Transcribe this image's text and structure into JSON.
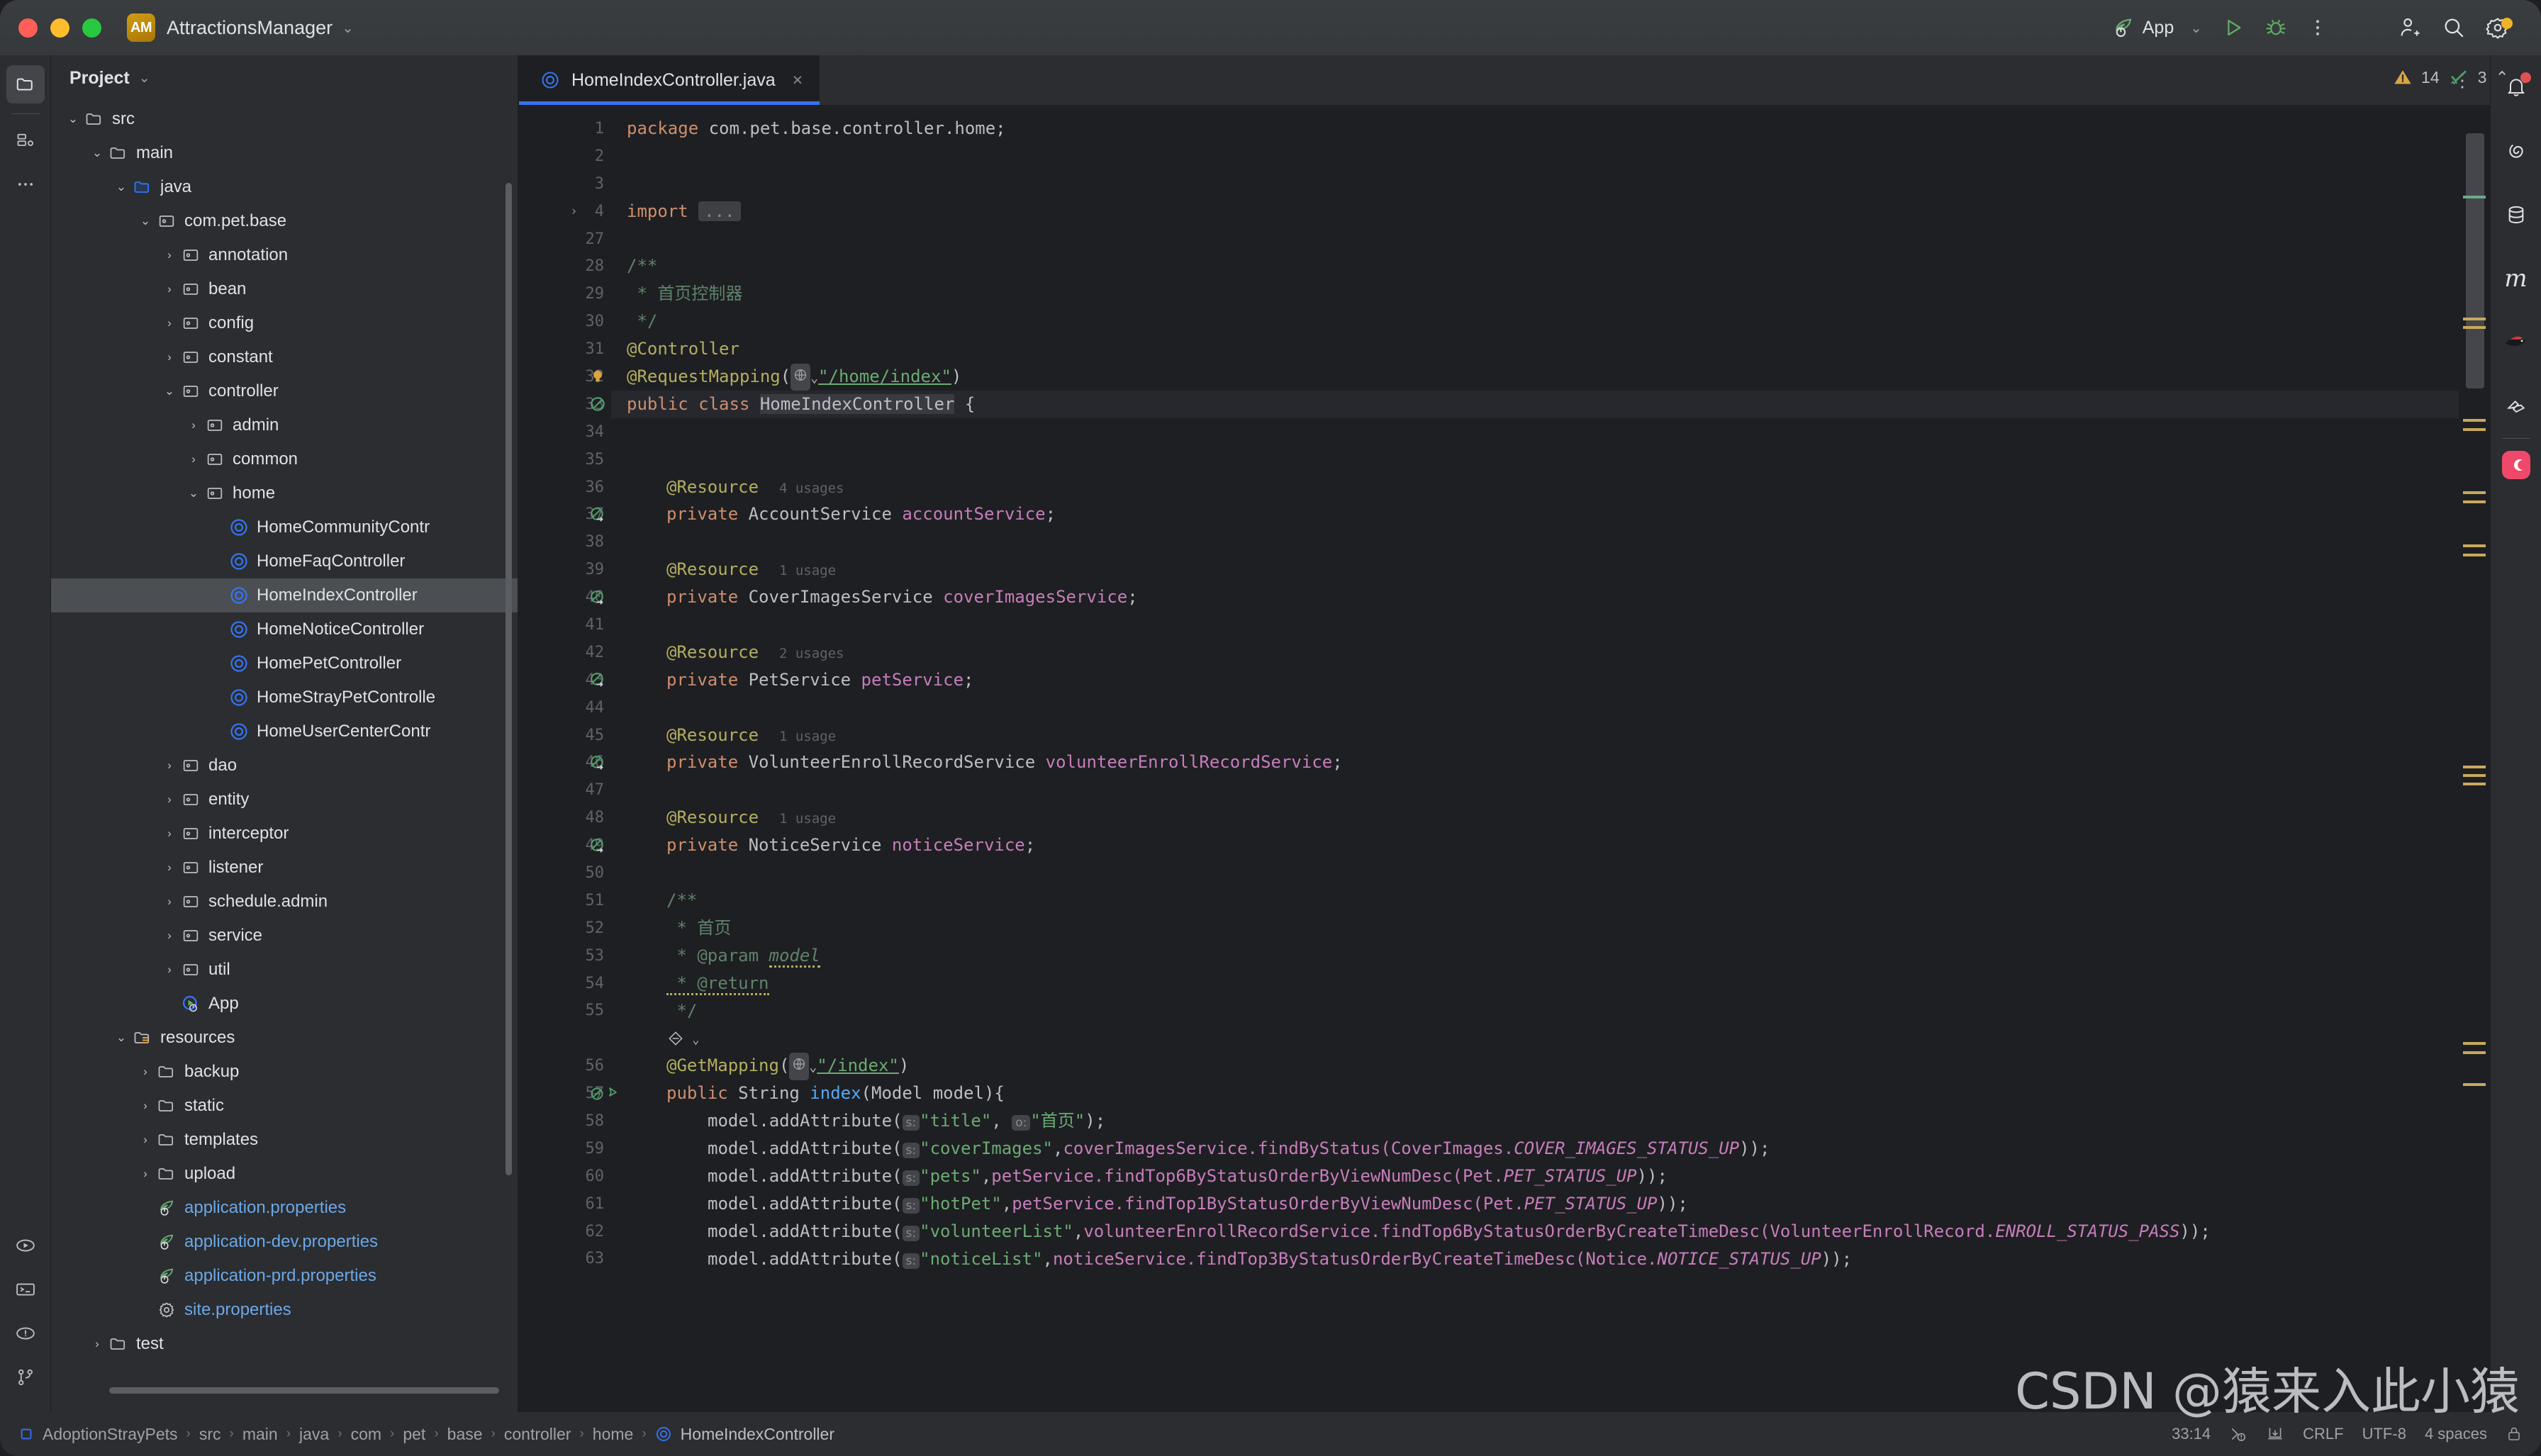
{
  "titlebar": {
    "project_initials": "AM",
    "project_name": "AttractionsManager",
    "dropdown_caret": "⌄",
    "run_config_label": "App",
    "run_config_caret": "⌄",
    "icons": {
      "run": "run-icon",
      "debug": "debug-icon",
      "more": "more-options-icon",
      "add_user": "add-user-icon",
      "search": "search-icon",
      "settings": "settings-icon"
    }
  },
  "left_rail": {
    "items": [
      {
        "name": "project-tool-window",
        "icon": "folder-icon",
        "active": true
      },
      {
        "name": "commit-tool-window",
        "icon": "commit-icon",
        "active": false
      },
      {
        "name": "more-tool-windows",
        "icon": "ellipsis-icon",
        "active": false
      }
    ],
    "bottom_items": [
      {
        "name": "run-tool-window",
        "icon": "run-circle-icon"
      },
      {
        "name": "terminal-tool-window",
        "icon": "terminal-icon"
      },
      {
        "name": "problems-tool-window",
        "icon": "problems-icon"
      },
      {
        "name": "version-control-tool-window",
        "icon": "git-branch-icon"
      }
    ]
  },
  "project_panel": {
    "title": "Project",
    "caret": "⌄",
    "tree": [
      {
        "label": "src",
        "indent": 1,
        "arrow": "v",
        "icon": "folder",
        "style": "plain"
      },
      {
        "label": "main",
        "indent": 2,
        "arrow": "v",
        "icon": "folder",
        "style": "plain"
      },
      {
        "label": "java",
        "indent": 3,
        "arrow": "v",
        "icon": "source",
        "style": "plain"
      },
      {
        "label": "com.pet.base",
        "indent": 4,
        "arrow": "v",
        "icon": "package",
        "style": "plain"
      },
      {
        "label": "annotation",
        "indent": 5,
        "arrow": ">",
        "icon": "package",
        "style": "plain"
      },
      {
        "label": "bean",
        "indent": 5,
        "arrow": ">",
        "icon": "package",
        "style": "plain"
      },
      {
        "label": "config",
        "indent": 5,
        "arrow": ">",
        "icon": "package",
        "style": "plain"
      },
      {
        "label": "constant",
        "indent": 5,
        "arrow": ">",
        "icon": "package",
        "style": "plain"
      },
      {
        "label": "controller",
        "indent": 5,
        "arrow": "v",
        "icon": "package",
        "style": "plain"
      },
      {
        "label": "admin",
        "indent": 6,
        "arrow": ">",
        "icon": "package",
        "style": "plain"
      },
      {
        "label": "common",
        "indent": 6,
        "arrow": ">",
        "icon": "package",
        "style": "plain"
      },
      {
        "label": "home",
        "indent": 6,
        "arrow": "v",
        "icon": "package",
        "style": "plain"
      },
      {
        "label": "HomeCommunityContr",
        "indent": 7,
        "arrow": "",
        "icon": "class",
        "style": "plain"
      },
      {
        "label": "HomeFaqController",
        "indent": 7,
        "arrow": "",
        "icon": "class",
        "style": "plain"
      },
      {
        "label": "HomeIndexController",
        "indent": 7,
        "arrow": "",
        "icon": "class",
        "style": "plain",
        "selected": true
      },
      {
        "label": "HomeNoticeController",
        "indent": 7,
        "arrow": "",
        "icon": "class",
        "style": "plain"
      },
      {
        "label": "HomePetController",
        "indent": 7,
        "arrow": "",
        "icon": "class",
        "style": "plain"
      },
      {
        "label": "HomeStrayPetControlle",
        "indent": 7,
        "arrow": "",
        "icon": "class",
        "style": "plain"
      },
      {
        "label": "HomeUserCenterContr",
        "indent": 7,
        "arrow": "",
        "icon": "class",
        "style": "plain"
      },
      {
        "label": "dao",
        "indent": 5,
        "arrow": ">",
        "icon": "package",
        "style": "plain"
      },
      {
        "label": "entity",
        "indent": 5,
        "arrow": ">",
        "icon": "package",
        "style": "plain"
      },
      {
        "label": "interceptor",
        "indent": 5,
        "arrow": ">",
        "icon": "package",
        "style": "plain"
      },
      {
        "label": "listener",
        "indent": 5,
        "arrow": ">",
        "icon": "package",
        "style": "plain"
      },
      {
        "label": "schedule.admin",
        "indent": 5,
        "arrow": ">",
        "icon": "package",
        "style": "plain"
      },
      {
        "label": "service",
        "indent": 5,
        "arrow": ">",
        "icon": "package",
        "style": "plain"
      },
      {
        "label": "util",
        "indent": 5,
        "arrow": ">",
        "icon": "package",
        "style": "plain"
      },
      {
        "label": "App",
        "indent": 5,
        "arrow": "",
        "icon": "springapp",
        "style": "plain"
      },
      {
        "label": "resources",
        "indent": 3,
        "arrow": "v",
        "icon": "resources",
        "style": "plain"
      },
      {
        "label": "backup",
        "indent": 4,
        "arrow": ">",
        "icon": "folder",
        "style": "plain"
      },
      {
        "label": "static",
        "indent": 4,
        "arrow": ">",
        "icon": "folder",
        "style": "plain"
      },
      {
        "label": "templates",
        "indent": 4,
        "arrow": ">",
        "icon": "folder",
        "style": "plain"
      },
      {
        "label": "upload",
        "indent": 4,
        "arrow": ">",
        "icon": "folder",
        "style": "plain"
      },
      {
        "label": "application.properties",
        "indent": 4,
        "arrow": "",
        "icon": "spring",
        "style": "blue"
      },
      {
        "label": "application-dev.properties",
        "indent": 4,
        "arrow": "",
        "icon": "spring",
        "style": "blue"
      },
      {
        "label": "application-prd.properties",
        "indent": 4,
        "arrow": "",
        "icon": "spring",
        "style": "blue"
      },
      {
        "label": "site.properties",
        "indent": 4,
        "arrow": "",
        "icon": "settings",
        "style": "blue"
      },
      {
        "label": "test",
        "indent": 2,
        "arrow": ">",
        "icon": "folder",
        "style": "plain"
      }
    ]
  },
  "editor": {
    "tab": {
      "label": "HomeIndexController.java",
      "close": "×",
      "icon": "java-class-icon"
    },
    "tab_more": "⋮",
    "inspections": {
      "warning_count": "14",
      "weak_warning_count": "3",
      "prev_caret": "⌃",
      "next_caret": "⌄"
    },
    "lines": [
      {
        "n": "1",
        "mark": ""
      },
      {
        "n": "2",
        "mark": ""
      },
      {
        "n": "3",
        "mark": ""
      },
      {
        "n": "4",
        "mark": "",
        "fold": ">"
      },
      {
        "n": "27",
        "mark": ""
      },
      {
        "n": "28",
        "mark": ""
      },
      {
        "n": "29",
        "mark": ""
      },
      {
        "n": "30",
        "mark": ""
      },
      {
        "n": "31",
        "mark": ""
      },
      {
        "n": "32",
        "mark": "bulb"
      },
      {
        "n": "33",
        "mark": "bean",
        "current": true
      },
      {
        "n": "34",
        "mark": ""
      },
      {
        "n": "35",
        "mark": ""
      },
      {
        "n": "36",
        "mark": ""
      },
      {
        "n": "37",
        "mark": "autowire"
      },
      {
        "n": "38",
        "mark": ""
      },
      {
        "n": "39",
        "mark": ""
      },
      {
        "n": "40",
        "mark": "autowire"
      },
      {
        "n": "41",
        "mark": ""
      },
      {
        "n": "42",
        "mark": ""
      },
      {
        "n": "43",
        "mark": "autowire"
      },
      {
        "n": "44",
        "mark": ""
      },
      {
        "n": "45",
        "mark": ""
      },
      {
        "n": "46",
        "mark": "autowire"
      },
      {
        "n": "47",
        "mark": ""
      },
      {
        "n": "48",
        "mark": ""
      },
      {
        "n": "49",
        "mark": "autowire"
      },
      {
        "n": "50",
        "mark": ""
      },
      {
        "n": "51",
        "mark": ""
      },
      {
        "n": "52",
        "mark": ""
      },
      {
        "n": "53",
        "mark": ""
      },
      {
        "n": "54",
        "mark": ""
      },
      {
        "n": "55",
        "mark": ""
      },
      {
        "n": "",
        "mark": ""
      },
      {
        "n": "56",
        "mark": ""
      },
      {
        "n": "57",
        "mark": "mapping"
      },
      {
        "n": "58",
        "mark": ""
      },
      {
        "n": "59",
        "mark": ""
      },
      {
        "n": "60",
        "mark": ""
      },
      {
        "n": "61",
        "mark": ""
      },
      {
        "n": "62",
        "mark": ""
      },
      {
        "n": "63",
        "mark": ""
      }
    ],
    "code_text": {
      "l1": "package com.pet.base.controller.home;",
      "l4_import": "import",
      "l4_dots": "...",
      "l28": "/**",
      "l29": " * 首页控制器",
      "l30": " */",
      "l31": "@Controller",
      "l32_ann": "@RequestMapping",
      "l32_url": "\"/home/index\"",
      "l33_public": "public",
      "l33_class": "class",
      "l33_name": "HomeIndexController",
      "l33_brace": "{",
      "res_annotation": "@Resource",
      "usage_4": "4 usages",
      "usage_1": "1 usage",
      "usage_2": "2 usages",
      "f37": "private AccountService accountService;",
      "f40": "private CoverImagesService coverImagesService;",
      "f43": "private PetService petService;",
      "f46": "private VolunteerEnrollRecordService volunteerEnrollRecordService;",
      "f49": "private NoticeService noticeService;",
      "l51": "/**",
      "l52": " * 首页",
      "l53_a": " * @param ",
      "l53_b": "model",
      "l54": " * @return",
      "l55": " */",
      "l56_ann": "@GetMapping",
      "l56_url": "\"/index\"",
      "l57": "public String index(Model model){",
      "l58_key": "\"title\"",
      "l58_val": "\"首页\"",
      "l59_key": "\"coverImages\"",
      "l59_call": "coverImagesService.findByStatus(CoverImages.",
      "l59_const": "COVER_IMAGES_STATUS_UP",
      "l60_key": "\"pets\"",
      "l60_call": "petService.findTop6ByStatusOrderByViewNumDesc(Pet.",
      "l60_const": "PET_STATUS_UP",
      "l61_key": "\"hotPet\"",
      "l61_call": "petService.findTop1ByStatusOrderByViewNumDesc(Pet.",
      "l61_const": "PET_STATUS_UP",
      "l62_key": "\"volunteerList\"",
      "l62_call": "volunteerEnrollRecordService.findTop6ByStatusOrderByCreateTimeDesc(VolunteerEnrollRecord.",
      "l62_const": "ENROLL_STATUS_PASS",
      "l63_key": "\"noticeList\"",
      "l63_call": "noticeService.findTop3ByStatusOrderByCreateTimeDesc(Notice.",
      "l63_const": "NOTICE_STATUS_UP",
      "chip_s": "s:",
      "chip_o": "o:",
      "model_add": "model.addAttribute("
    }
  },
  "right_rail": {
    "items": [
      {
        "name": "notifications",
        "icon": "bell-icon",
        "badge": true
      },
      {
        "name": "ai-assistant",
        "icon": "spiral-icon"
      },
      {
        "name": "database",
        "icon": "database-icon"
      },
      {
        "name": "maven",
        "icon": "maven-m-icon"
      },
      {
        "name": "mybatisx",
        "icon": "bird-icon"
      },
      {
        "name": "plugin-tool",
        "icon": "origami-icon"
      },
      {
        "name": "app-shortcut",
        "icon": "moon-badge-icon"
      }
    ]
  },
  "status_bar": {
    "breadcrumb": [
      "AdoptionStrayPets",
      "src",
      "main",
      "java",
      "com",
      "pet",
      "base",
      "controller",
      "home",
      "HomeIndexController"
    ],
    "separator": "›",
    "position": "33:14",
    "line_sep": "CRLF",
    "encoding": "UTF-8",
    "indent": "4 spaces",
    "icons": {
      "inspections": "inspections-icon",
      "memory": "memory-icon",
      "lock": "lock-icon"
    }
  },
  "watermark": {
    "text": "CSDN @猿来入此小猿"
  },
  "colors": {
    "accent": "#3574f0",
    "warning": "#c8a95c",
    "spring_green": "#6aab73",
    "selection": "#4b4e52",
    "panel_bg": "#2b2d30",
    "editor_bg": "#1e1f22"
  }
}
